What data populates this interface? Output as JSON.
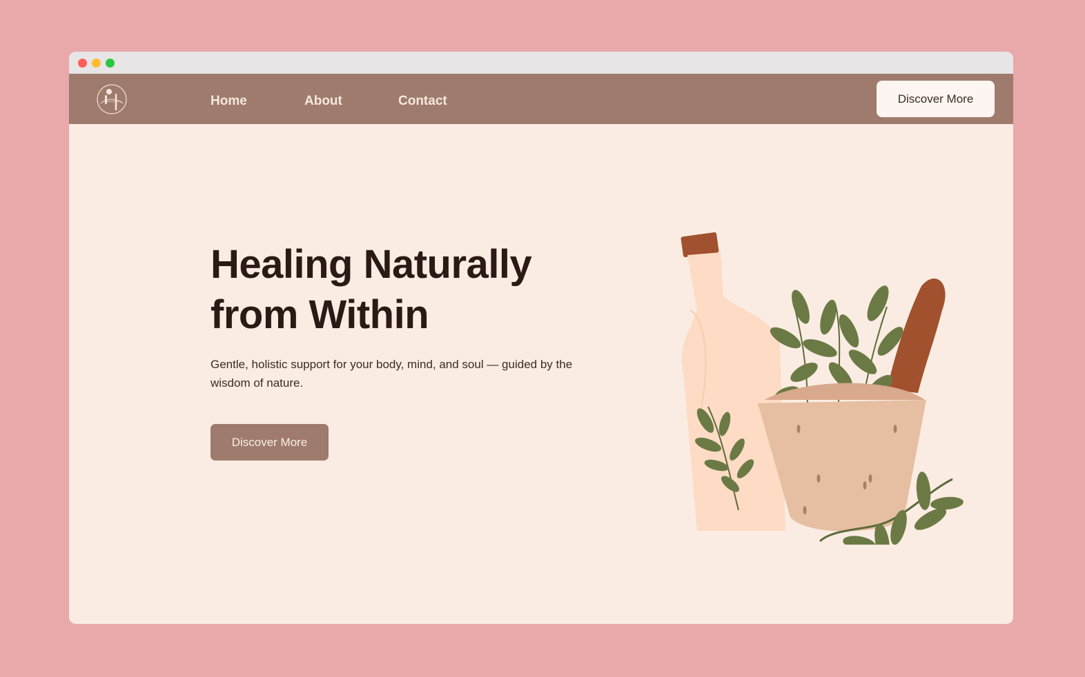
{
  "window": {
    "controls": [
      "close",
      "minimize",
      "maximize"
    ]
  },
  "navbar": {
    "logo_icon": "logo-icon",
    "links": [
      {
        "label": "Home"
      },
      {
        "label": "About"
      },
      {
        "label": "Contact"
      }
    ],
    "cta_label": "Discover More"
  },
  "hero": {
    "title_line1": "Healing Naturally",
    "title_line2": "from Within",
    "subtitle": "Gentle, holistic support for your body, mind, and soul — guided by the wisdom of nature.",
    "cta_label": "Discover More",
    "illustration_icon": "herbal-mortar-bottle-illustration"
  },
  "colors": {
    "page_background": "#e9a8aa",
    "content_background": "#faece2",
    "navbar": "#9e7b6c",
    "heading": "#2a1a13",
    "leaf_green": "#6b7a45",
    "accent_brown": "#a1512e"
  }
}
